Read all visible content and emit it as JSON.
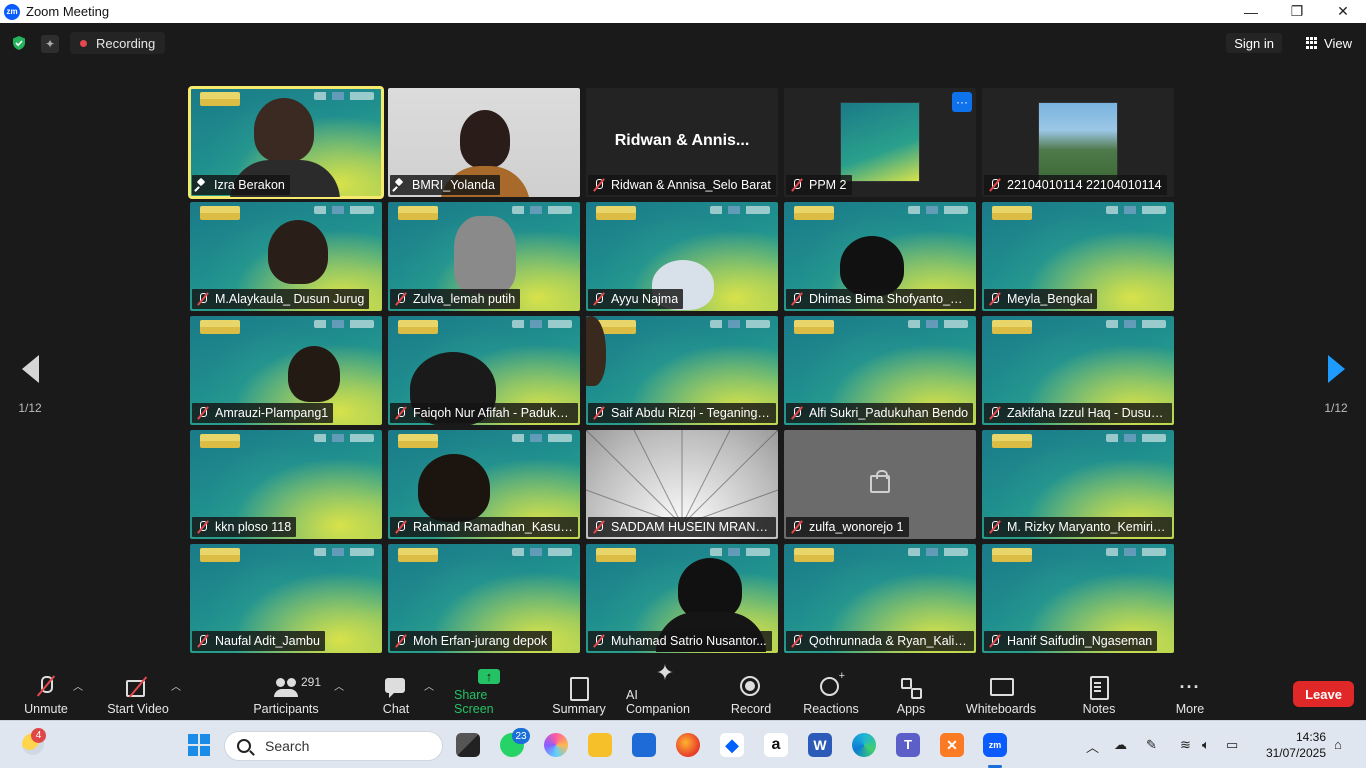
{
  "window": {
    "title": "Zoom Meeting",
    "logo_text": "zm"
  },
  "topbar": {
    "recording_label": "Recording",
    "signin_label": "Sign in",
    "view_label": "View"
  },
  "nav": {
    "page_left": "1/12",
    "page_right": "1/12"
  },
  "tiles": [
    {
      "name": "Izra Berakon",
      "state": "active",
      "mic": "pin"
    },
    {
      "name": "BMRI_Yolanda",
      "state": "video",
      "mic": "pin"
    },
    {
      "name": "Ridwan & Annisa_Selo Barat",
      "state": "name-only",
      "mic": "muted",
      "center_name": "Ridwan & Annis..."
    },
    {
      "name": "PPM 2",
      "state": "poster",
      "mic": "muted"
    },
    {
      "name": "22104010114 22104010114",
      "state": "photo",
      "mic": "muted"
    },
    {
      "name": "M.Alaykaula_ Dusun Jurug",
      "state": "bg",
      "mic": "muted"
    },
    {
      "name": "Zulva_lemah putih",
      "state": "bg",
      "mic": "muted"
    },
    {
      "name": "Ayyu Najma",
      "state": "bg",
      "mic": "muted"
    },
    {
      "name": "Dhimas Bima Shofyanto_Be...",
      "state": "bg",
      "mic": "muted"
    },
    {
      "name": "Meyla_Bengkal",
      "state": "bg",
      "mic": "muted"
    },
    {
      "name": "Amrauzi-Plampang1",
      "state": "bg",
      "mic": "muted"
    },
    {
      "name": "Faiqoh Nur Afifah - Paduku...",
      "state": "bg",
      "mic": "muted"
    },
    {
      "name": "Saif Abdu Rizqi - Teganing ...",
      "state": "bg",
      "mic": "muted"
    },
    {
      "name": "Alfi Sukri_Padukuhan Bendo",
      "state": "bg",
      "mic": "muted"
    },
    {
      "name": "Zakifaha Izzul Haq - Dusun ...",
      "state": "bg",
      "mic": "muted"
    },
    {
      "name": "kkn ploso 118",
      "state": "bg",
      "mic": "muted"
    },
    {
      "name": "Rahmad Ramadhan_Kasuran",
      "state": "bg",
      "mic": "muted"
    },
    {
      "name": "SADDAM HUSEIN MRANG...",
      "state": "spider",
      "mic": "muted"
    },
    {
      "name": "zulfa_wonorejo 1",
      "state": "off",
      "mic": "muted"
    },
    {
      "name": "M. Rizky Maryanto_Kemiri-...",
      "state": "bg",
      "mic": "muted"
    },
    {
      "name": "Naufal Adit_Jambu",
      "state": "bg",
      "mic": "muted"
    },
    {
      "name": "Moh Erfan-jurang depok",
      "state": "bg",
      "mic": "muted"
    },
    {
      "name": "Muhamad Satrio Nusantor...",
      "state": "bg",
      "mic": "muted"
    },
    {
      "name": "Qothrunnada & Ryan_Kalis...",
      "state": "bg",
      "mic": "muted"
    },
    {
      "name": "Hanif Saifudin_Ngaseman",
      "state": "bg",
      "mic": "muted"
    }
  ],
  "toolbar": {
    "unmute": "Unmute",
    "start_video": "Start Video",
    "participants": "Participants",
    "participants_count": "291",
    "chat": "Chat",
    "share_screen": "Share Screen",
    "summary": "Summary",
    "ai_companion": "AI Companion",
    "record": "Record",
    "reactions": "Reactions",
    "apps": "Apps",
    "whiteboards": "Whiteboards",
    "notes": "Notes",
    "more": "More",
    "leave": "Leave"
  },
  "taskbar": {
    "weather_badge": "4",
    "search_placeholder": "Search",
    "whatsapp_badge": "23",
    "time": "14:36",
    "date": "31/07/2025"
  },
  "colors": {
    "accent": "#0b5cff",
    "share_green": "#24c265",
    "leave_red": "#e02828",
    "active_speaker": "#f5e96e",
    "muted_red": "#e5484d"
  }
}
